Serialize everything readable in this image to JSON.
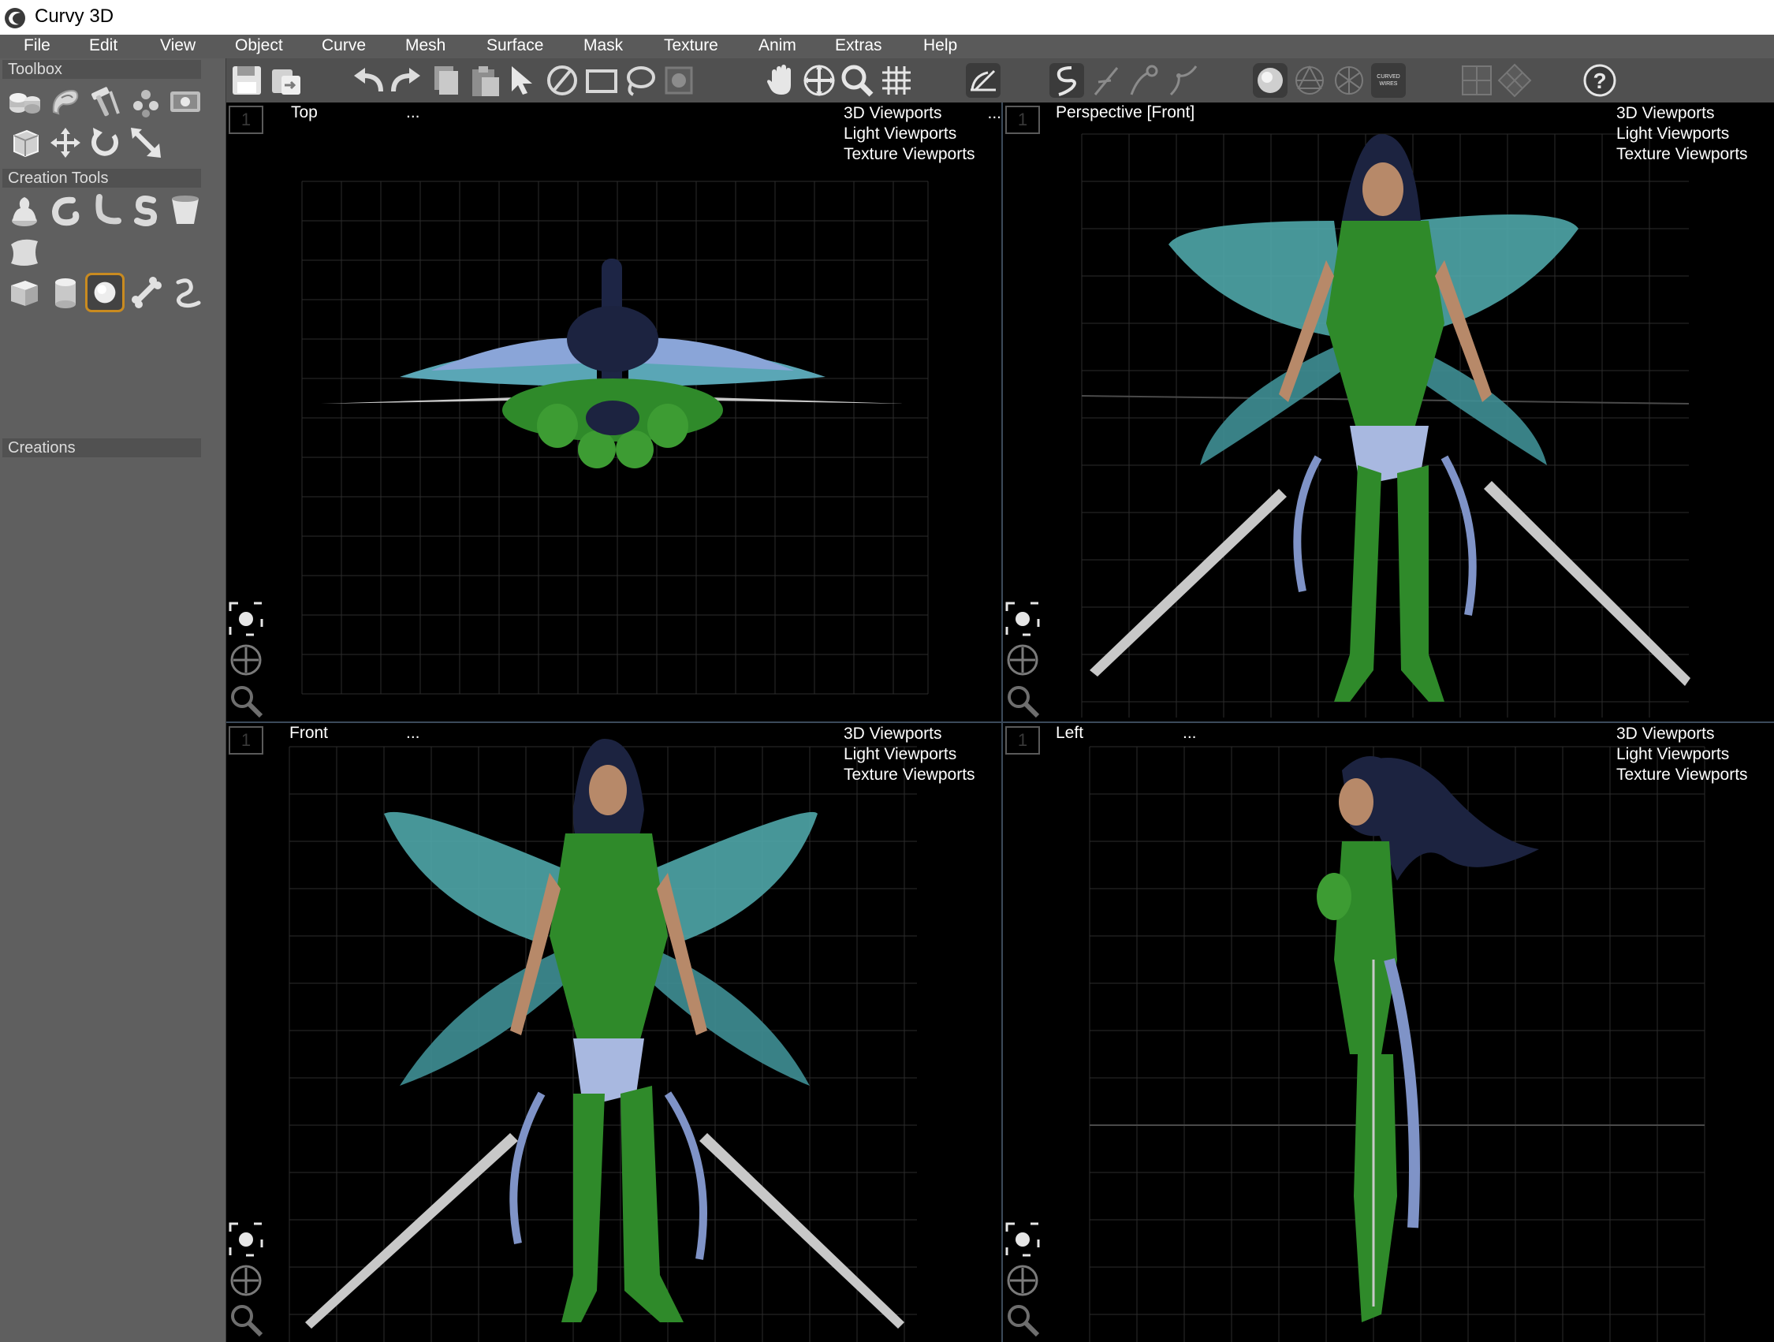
{
  "window": {
    "title": "Curvy 3D"
  },
  "menu": [
    "File",
    "Edit",
    "View",
    "Object",
    "Curve",
    "Mesh",
    "Surface",
    "Mask",
    "Texture",
    "Anim",
    "Extras",
    "Help"
  ],
  "toolbox": {
    "sections": {
      "toolbox": "Toolbox",
      "creation_tools": "Creation Tools",
      "creations": "Creations"
    }
  },
  "toolbar": {
    "curved_wires_label_line1": "CURVED",
    "curved_wires_label_line2": "WIRES"
  },
  "viewports": {
    "menu_items": [
      "3D Viewports",
      "Light Viewports",
      "Texture Viewports"
    ],
    "menu_ellipsis": "...",
    "number": "1",
    "top": {
      "title": "Top",
      "dots": "..."
    },
    "perspective": {
      "title": "Perspective [Front]"
    },
    "front": {
      "title": "Front",
      "dots": "..."
    },
    "left": {
      "title": "Left",
      "dots": "..."
    }
  },
  "colors": {
    "menu_bg": "#5a5a5a",
    "panel_bg": "#5f5f5f",
    "active_tool_border": "#c98b20",
    "model_green": "#2f8a2a",
    "wing_teal": "#4fa6a8",
    "hair_navy": "#1c2340"
  }
}
